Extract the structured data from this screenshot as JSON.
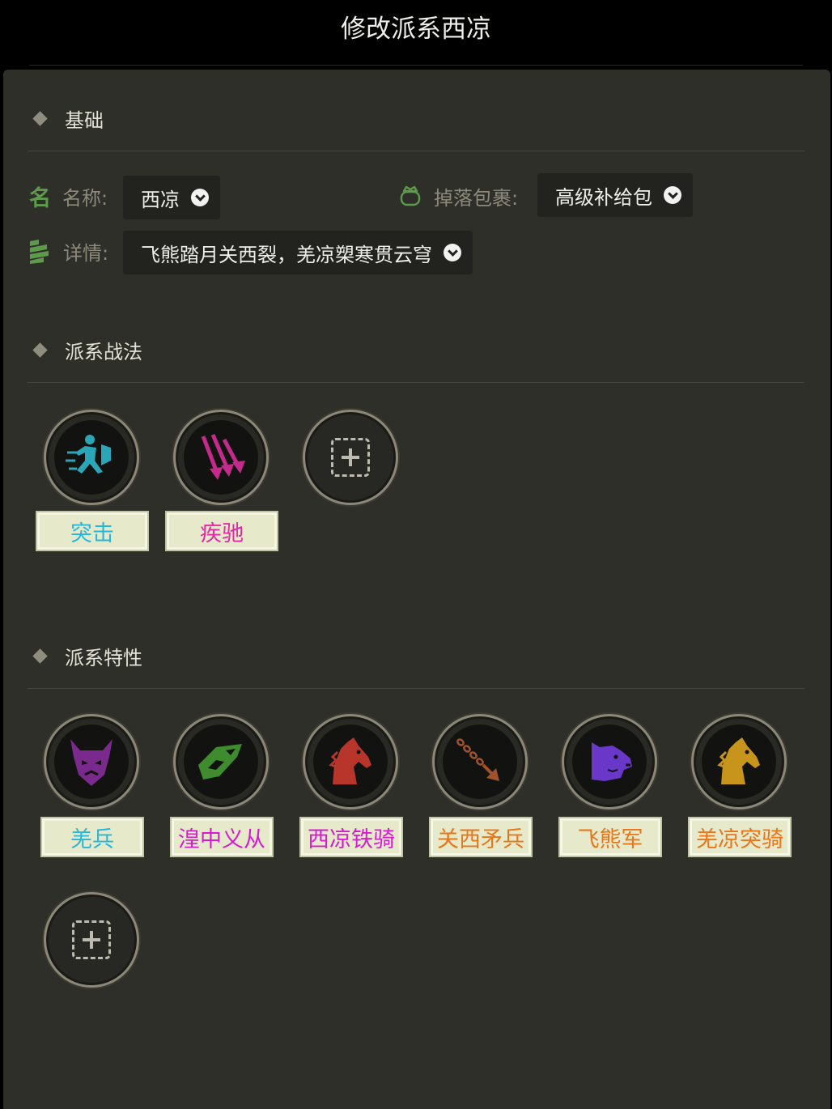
{
  "header": {
    "title": "修改派系西凉"
  },
  "sections": {
    "basic": {
      "title": "基础"
    },
    "tactics": {
      "title": "派系战法"
    },
    "traits": {
      "title": "派系特性"
    }
  },
  "fields": {
    "name": {
      "icon_char": "名",
      "label": "名称:",
      "value": "西凉"
    },
    "drop": {
      "label": "掉落包裹:",
      "value": "高级补给包"
    },
    "detail": {
      "label": "详情:",
      "value": "飞熊踏月关西裂，羌凉槊寒贯云穹"
    }
  },
  "tactics": [
    {
      "name": "突击",
      "icon": "charge-runner-icon",
      "color": "#29b6d8"
    },
    {
      "name": "疾驰",
      "icon": "triple-arrow-icon",
      "color": "#e02aa6"
    }
  ],
  "traits": [
    {
      "name": "羌兵",
      "icon": "demon-mask-icon",
      "color": "#29b6d8",
      "icon_color": "#7a2a8c"
    },
    {
      "name": "湟中义从",
      "icon": "scroll-leaf-icon",
      "color": "#d81ad0",
      "icon_color": "#3e8c2e"
    },
    {
      "name": "西凉铁骑",
      "icon": "horse-head-icon",
      "color": "#d81ad0",
      "icon_color": "#b8352c"
    },
    {
      "name": "关西矛兵",
      "icon": "chain-spear-icon",
      "color": "#e8761a",
      "icon_color": "#a0522d"
    },
    {
      "name": "飞熊军",
      "icon": "bear-head-icon",
      "color": "#e8761a",
      "icon_color": "#6a38c8"
    },
    {
      "name": "羌凉突骑",
      "icon": "horse-head-icon",
      "color": "#e8761a",
      "icon_color": "#c7941c"
    }
  ],
  "colors": {
    "accent_green": "#5d9a4c",
    "panel": "#2e2f29"
  }
}
